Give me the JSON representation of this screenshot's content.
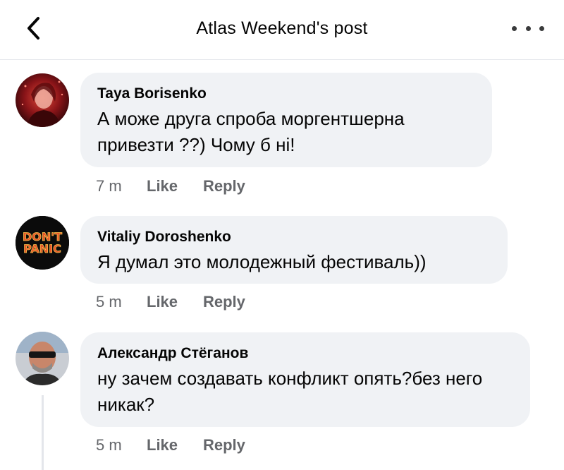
{
  "header": {
    "title": "Atlas Weekend's post"
  },
  "comments": [
    {
      "author": "Taya  Borisenko",
      "text": "А може друга спроба моргентшерна привезти ??) Чому б ні!",
      "time": "7 m",
      "like": "Like",
      "reply": "Reply",
      "avatar_icon": "person-photo"
    },
    {
      "author": "Vitaliy Doroshenko",
      "text": "Я думал это молодежный фестиваль))",
      "time": "5 m",
      "like": "Like",
      "reply": "Reply",
      "avatar_icon": "dont-panic-logo",
      "avatar_logo_text": "DON'T PANIC"
    },
    {
      "author": "Александр Стёганов",
      "text": "ну зачем создавать конфликт опять?без него никак?",
      "time": "5 m",
      "like": "Like",
      "reply": "Reply",
      "avatar_icon": "person-photo"
    }
  ],
  "colors": {
    "bubble": "#f0f2f5",
    "meta_text": "#65676b",
    "primary_text": "#050505"
  }
}
